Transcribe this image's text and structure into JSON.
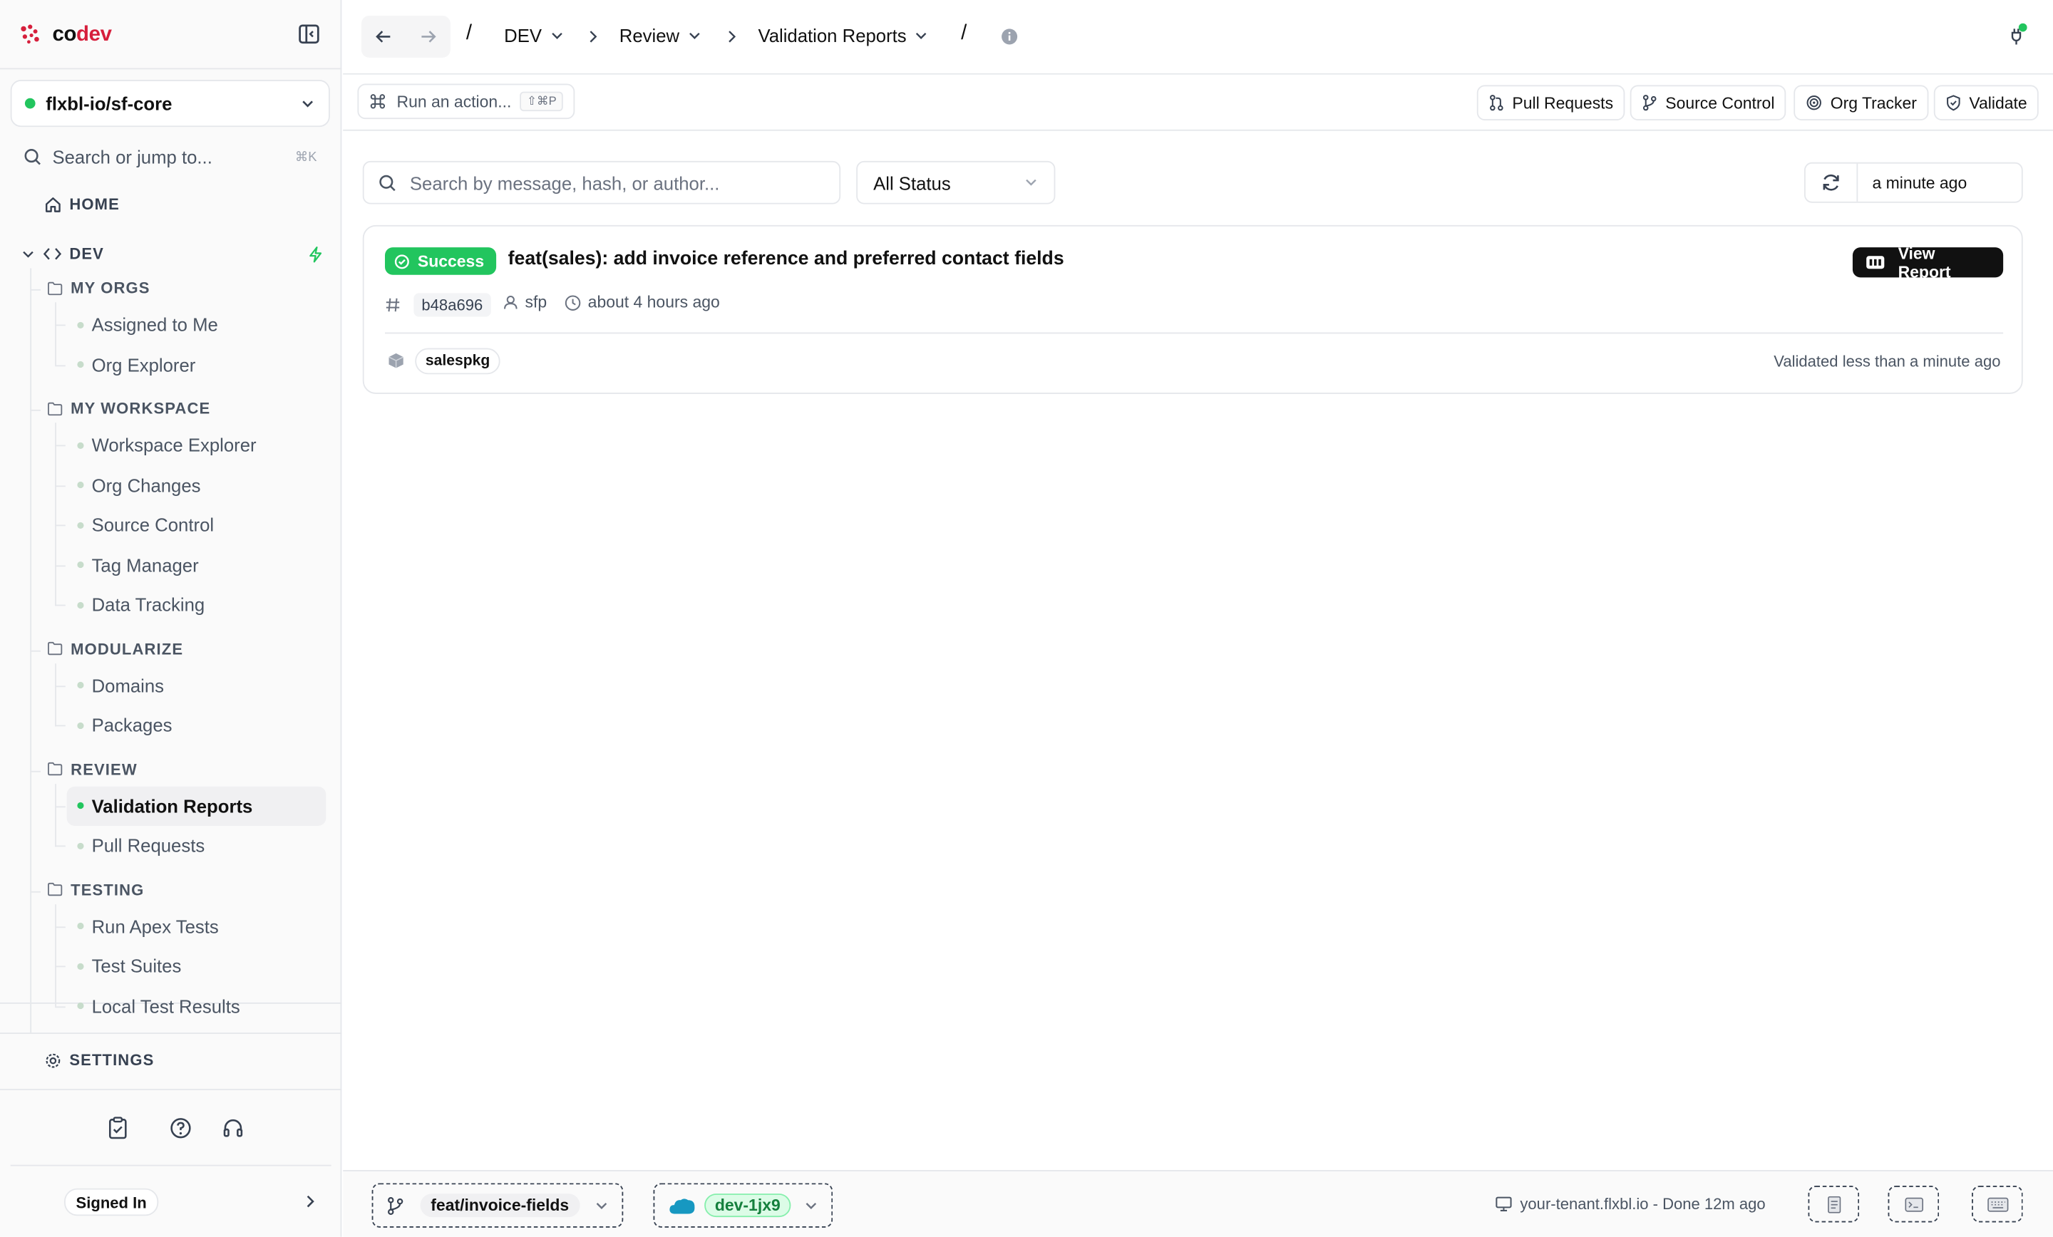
{
  "brand": {
    "name_prefix": "co",
    "name_suffix": "dev"
  },
  "org_selector": {
    "value": "flxbl-io/sf-core",
    "status_color": "#22c55e"
  },
  "search": {
    "label": "Search or jump to...",
    "shortcut": "⌘K"
  },
  "nav": {
    "home": "HOME",
    "dev": "DEV",
    "sections": [
      {
        "title": "MY ORGS",
        "items": [
          "Assigned to Me",
          "Org Explorer"
        ]
      },
      {
        "title": "MY WORKSPACE",
        "items": [
          "Workspace Explorer",
          "Org Changes",
          "Source Control",
          "Tag Manager",
          "Data Tracking"
        ]
      },
      {
        "title": "MODULARIZE",
        "items": [
          "Domains",
          "Packages"
        ]
      },
      {
        "title": "REVIEW",
        "items": [
          "Validation Reports",
          "Pull Requests"
        ]
      },
      {
        "title": "TESTING",
        "items": [
          "Run Apex Tests",
          "Test Suites",
          "Local Test Results"
        ]
      }
    ],
    "active_item": "Validation Reports",
    "settings": "SETTINGS"
  },
  "account": {
    "status": "Signed In"
  },
  "breadcrumb": {
    "sep": "/",
    "items": [
      "DEV",
      "Review",
      "Validation Reports"
    ]
  },
  "actions": {
    "run_placeholder": "Run an action...",
    "run_shortcut": "⇧⌘P",
    "buttons": [
      "Pull Requests",
      "Source Control",
      "Org Tracker",
      "Validate"
    ]
  },
  "filters": {
    "search_placeholder": "Search by message, hash, or author...",
    "status": "All Status",
    "last_refreshed": "a minute ago"
  },
  "reports": [
    {
      "status": "Success",
      "title": "feat(sales): add invoice reference and preferred contact fields",
      "hash": "b48a696",
      "author": "sfp",
      "time": "about 4 hours ago",
      "package": "salespkg",
      "validated": "Validated less than a minute ago",
      "action": "View Report"
    }
  ],
  "statusbar": {
    "branch": "feat/invoice-fields",
    "org": "dev-1jx9",
    "tenant": "your-tenant.flxbl.io - Done 12m ago"
  },
  "colors": {
    "accent": "#d61f3c",
    "success": "#22c55e",
    "primary_dark": "#111111"
  }
}
